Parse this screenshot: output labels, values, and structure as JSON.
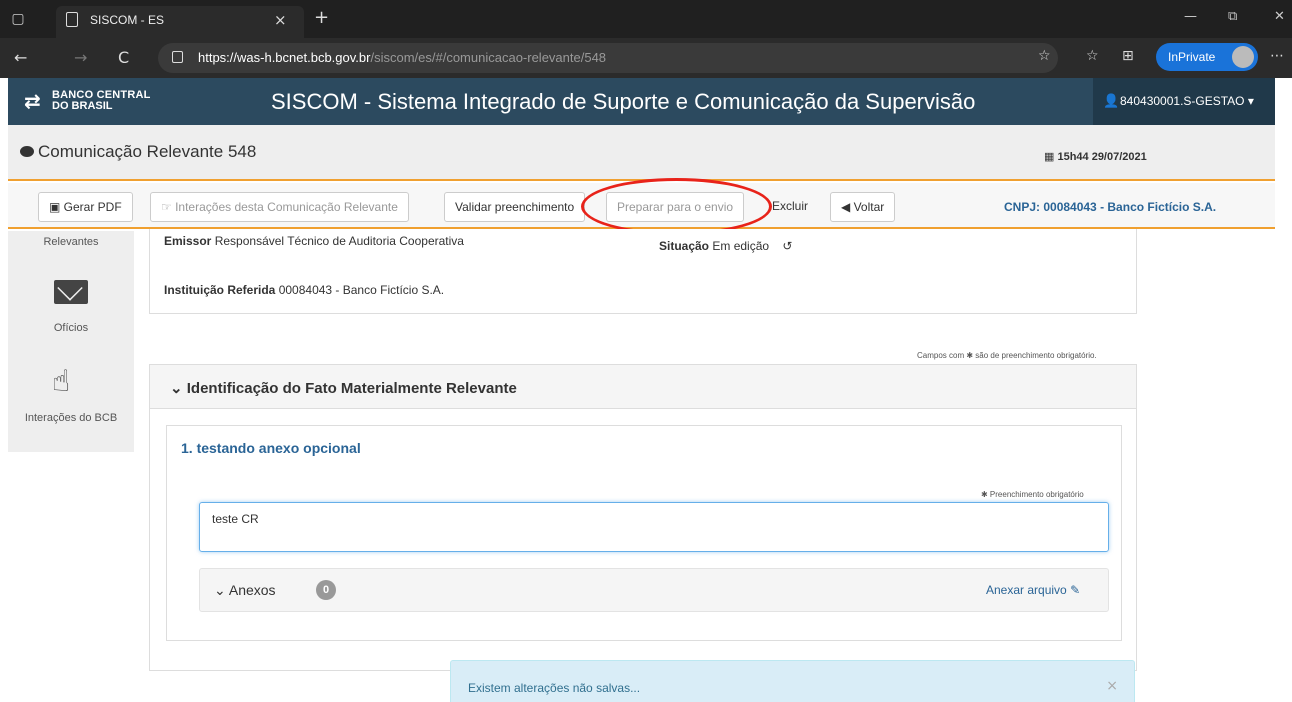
{
  "browser": {
    "tab_title": "SISCOM - ES",
    "tab_close": "×",
    "new_tab": "+",
    "url_host": "https://was-h.bcnet.bcb.gov.br",
    "url_path": "/siscom/es/#/comunicacao-relevante/548",
    "inprivate": "InPrivate",
    "back": "←",
    "forward": "→",
    "refresh": "C",
    "minimize": "—",
    "restore": "⧉",
    "close": "✕",
    "more": "⋯"
  },
  "header": {
    "logo_line1": "BANCO CENTRAL",
    "logo_line2": "DO BRASIL",
    "app_title": "SISCOM - Sistema Integrado de Suporte e Comunicação da Supervisão",
    "user": "840430001.S-GESTAO ▾"
  },
  "page": {
    "title": "Comunicação Relevante 548",
    "datetime": "15h44 29/07/2021"
  },
  "toolbar": {
    "gerar_pdf": "Gerar PDF",
    "interacoes": "Interações desta Comunicação Relevante",
    "validar": "Validar preenchimento",
    "preparar": "Preparar para o envio",
    "excluir": "Excluir",
    "voltar": "Voltar",
    "cnpj": "CNPJ: 00084043 - Banco Fictício S.A."
  },
  "sidebar": {
    "relevantes": "Relevantes",
    "oficios": "Ofícios",
    "interacoes_bcb": "Interações do BCB"
  },
  "info": {
    "emissor_label": "Emissor",
    "emissor_value": "Responsável Técnico de Auditoria Cooperativa",
    "situacao_label": "Situação",
    "situacao_value": "Em edição",
    "instituicao_label": "Instituição Referida",
    "instituicao_value": "00084043 - Banco Fictício S.A."
  },
  "form": {
    "required_note": "Campos com ✱ são de preenchimento obrigatório.",
    "section_title": "Identificação do Fato Materialmente Relevante",
    "question": "1.  testando anexo opcional",
    "required_field": "✱ Preenchimento obrigatório",
    "answer": "teste CR",
    "anexos_label": "Anexos",
    "anexos_count": "0",
    "anexar": "Anexar arquivo"
  },
  "toast": {
    "message": "Existem alterações não salvas...",
    "close": "×"
  },
  "colors": {
    "header_bg": "#2c4a5f",
    "accent_orange": "#f0a030",
    "link_blue": "#2a6496",
    "annotation_red": "#e8231a"
  }
}
